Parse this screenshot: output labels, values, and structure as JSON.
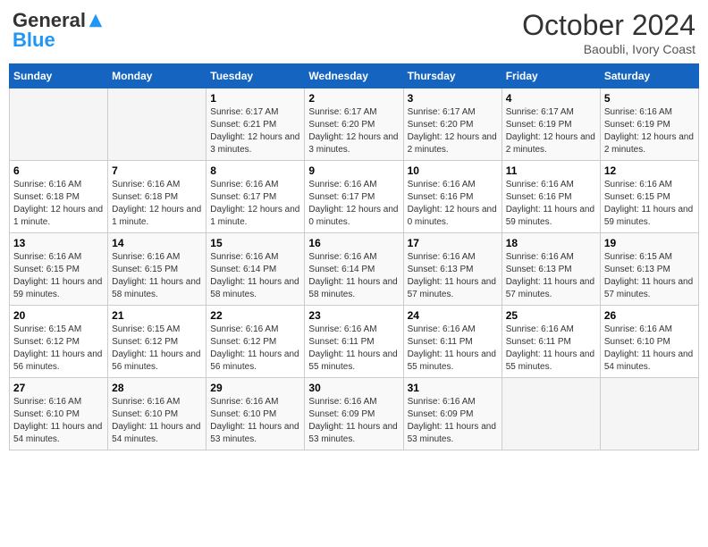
{
  "header": {
    "logo_general": "General",
    "logo_blue": "Blue",
    "month_title": "October 2024",
    "location": "Baoubli, Ivory Coast"
  },
  "days_of_week": [
    "Sunday",
    "Monday",
    "Tuesday",
    "Wednesday",
    "Thursday",
    "Friday",
    "Saturday"
  ],
  "weeks": [
    [
      null,
      null,
      {
        "day": 1,
        "sunrise": "Sunrise: 6:17 AM",
        "sunset": "Sunset: 6:21 PM",
        "daylight": "Daylight: 12 hours and 3 minutes."
      },
      {
        "day": 2,
        "sunrise": "Sunrise: 6:17 AM",
        "sunset": "Sunset: 6:20 PM",
        "daylight": "Daylight: 12 hours and 3 minutes."
      },
      {
        "day": 3,
        "sunrise": "Sunrise: 6:17 AM",
        "sunset": "Sunset: 6:20 PM",
        "daylight": "Daylight: 12 hours and 2 minutes."
      },
      {
        "day": 4,
        "sunrise": "Sunrise: 6:17 AM",
        "sunset": "Sunset: 6:19 PM",
        "daylight": "Daylight: 12 hours and 2 minutes."
      },
      {
        "day": 5,
        "sunrise": "Sunrise: 6:16 AM",
        "sunset": "Sunset: 6:19 PM",
        "daylight": "Daylight: 12 hours and 2 minutes."
      }
    ],
    [
      {
        "day": 6,
        "sunrise": "Sunrise: 6:16 AM",
        "sunset": "Sunset: 6:18 PM",
        "daylight": "Daylight: 12 hours and 1 minute."
      },
      {
        "day": 7,
        "sunrise": "Sunrise: 6:16 AM",
        "sunset": "Sunset: 6:18 PM",
        "daylight": "Daylight: 12 hours and 1 minute."
      },
      {
        "day": 8,
        "sunrise": "Sunrise: 6:16 AM",
        "sunset": "Sunset: 6:17 PM",
        "daylight": "Daylight: 12 hours and 1 minute."
      },
      {
        "day": 9,
        "sunrise": "Sunrise: 6:16 AM",
        "sunset": "Sunset: 6:17 PM",
        "daylight": "Daylight: 12 hours and 0 minutes."
      },
      {
        "day": 10,
        "sunrise": "Sunrise: 6:16 AM",
        "sunset": "Sunset: 6:16 PM",
        "daylight": "Daylight: 12 hours and 0 minutes."
      },
      {
        "day": 11,
        "sunrise": "Sunrise: 6:16 AM",
        "sunset": "Sunset: 6:16 PM",
        "daylight": "Daylight: 11 hours and 59 minutes."
      },
      {
        "day": 12,
        "sunrise": "Sunrise: 6:16 AM",
        "sunset": "Sunset: 6:15 PM",
        "daylight": "Daylight: 11 hours and 59 minutes."
      }
    ],
    [
      {
        "day": 13,
        "sunrise": "Sunrise: 6:16 AM",
        "sunset": "Sunset: 6:15 PM",
        "daylight": "Daylight: 11 hours and 59 minutes."
      },
      {
        "day": 14,
        "sunrise": "Sunrise: 6:16 AM",
        "sunset": "Sunset: 6:15 PM",
        "daylight": "Daylight: 11 hours and 58 minutes."
      },
      {
        "day": 15,
        "sunrise": "Sunrise: 6:16 AM",
        "sunset": "Sunset: 6:14 PM",
        "daylight": "Daylight: 11 hours and 58 minutes."
      },
      {
        "day": 16,
        "sunrise": "Sunrise: 6:16 AM",
        "sunset": "Sunset: 6:14 PM",
        "daylight": "Daylight: 11 hours and 58 minutes."
      },
      {
        "day": 17,
        "sunrise": "Sunrise: 6:16 AM",
        "sunset": "Sunset: 6:13 PM",
        "daylight": "Daylight: 11 hours and 57 minutes."
      },
      {
        "day": 18,
        "sunrise": "Sunrise: 6:16 AM",
        "sunset": "Sunset: 6:13 PM",
        "daylight": "Daylight: 11 hours and 57 minutes."
      },
      {
        "day": 19,
        "sunrise": "Sunrise: 6:15 AM",
        "sunset": "Sunset: 6:13 PM",
        "daylight": "Daylight: 11 hours and 57 minutes."
      }
    ],
    [
      {
        "day": 20,
        "sunrise": "Sunrise: 6:15 AM",
        "sunset": "Sunset: 6:12 PM",
        "daylight": "Daylight: 11 hours and 56 minutes."
      },
      {
        "day": 21,
        "sunrise": "Sunrise: 6:15 AM",
        "sunset": "Sunset: 6:12 PM",
        "daylight": "Daylight: 11 hours and 56 minutes."
      },
      {
        "day": 22,
        "sunrise": "Sunrise: 6:16 AM",
        "sunset": "Sunset: 6:12 PM",
        "daylight": "Daylight: 11 hours and 56 minutes."
      },
      {
        "day": 23,
        "sunrise": "Sunrise: 6:16 AM",
        "sunset": "Sunset: 6:11 PM",
        "daylight": "Daylight: 11 hours and 55 minutes."
      },
      {
        "day": 24,
        "sunrise": "Sunrise: 6:16 AM",
        "sunset": "Sunset: 6:11 PM",
        "daylight": "Daylight: 11 hours and 55 minutes."
      },
      {
        "day": 25,
        "sunrise": "Sunrise: 6:16 AM",
        "sunset": "Sunset: 6:11 PM",
        "daylight": "Daylight: 11 hours and 55 minutes."
      },
      {
        "day": 26,
        "sunrise": "Sunrise: 6:16 AM",
        "sunset": "Sunset: 6:10 PM",
        "daylight": "Daylight: 11 hours and 54 minutes."
      }
    ],
    [
      {
        "day": 27,
        "sunrise": "Sunrise: 6:16 AM",
        "sunset": "Sunset: 6:10 PM",
        "daylight": "Daylight: 11 hours and 54 minutes."
      },
      {
        "day": 28,
        "sunrise": "Sunrise: 6:16 AM",
        "sunset": "Sunset: 6:10 PM",
        "daylight": "Daylight: 11 hours and 54 minutes."
      },
      {
        "day": 29,
        "sunrise": "Sunrise: 6:16 AM",
        "sunset": "Sunset: 6:10 PM",
        "daylight": "Daylight: 11 hours and 53 minutes."
      },
      {
        "day": 30,
        "sunrise": "Sunrise: 6:16 AM",
        "sunset": "Sunset: 6:09 PM",
        "daylight": "Daylight: 11 hours and 53 minutes."
      },
      {
        "day": 31,
        "sunrise": "Sunrise: 6:16 AM",
        "sunset": "Sunset: 6:09 PM",
        "daylight": "Daylight: 11 hours and 53 minutes."
      },
      null,
      null
    ]
  ]
}
